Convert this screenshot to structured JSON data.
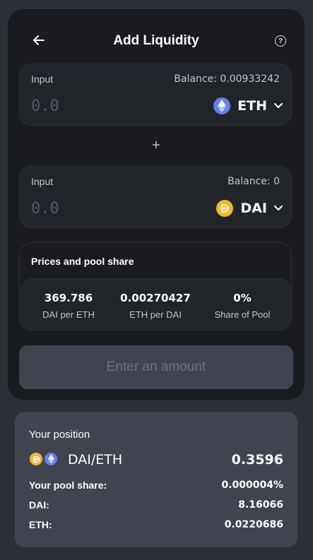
{
  "header": {
    "title": "Add Liquidity",
    "back_icon": "arrow-left-icon",
    "help_icon": "question-circle-icon",
    "help_glyph": "?"
  },
  "input_a": {
    "label": "Input",
    "balance": "Balance: 0.00933242",
    "placeholder": "0.0",
    "token": "ETH",
    "icon": "eth-icon"
  },
  "plus": "+",
  "input_b": {
    "label": "Input",
    "balance": "Balance: 0",
    "placeholder": "0.0",
    "token": "DAI",
    "icon": "dai-icon"
  },
  "prices": {
    "title": "Prices and pool share",
    "stats": [
      {
        "value": "369.786",
        "label": "DAI per ETH"
      },
      {
        "value": "0.00270427",
        "label": "ETH per DAI"
      },
      {
        "value": "0%",
        "label": "Share of Pool"
      }
    ]
  },
  "action_button": "Enter an amount",
  "position": {
    "title": "Your position",
    "pair": "DAI/ETH",
    "pair_value": "0.3596",
    "rows": [
      {
        "label": "Your pool share:",
        "value": "0.000004%"
      },
      {
        "label": "DAI:",
        "value": "8.16066"
      },
      {
        "label": "ETH:",
        "value": "0.0220686"
      }
    ]
  },
  "colors": {
    "background": "#2b2f36",
    "card": "#191b1f",
    "panel": "#212429",
    "button_disabled": "#40444f",
    "eth": "#627eea",
    "dai": "#f4b731"
  }
}
